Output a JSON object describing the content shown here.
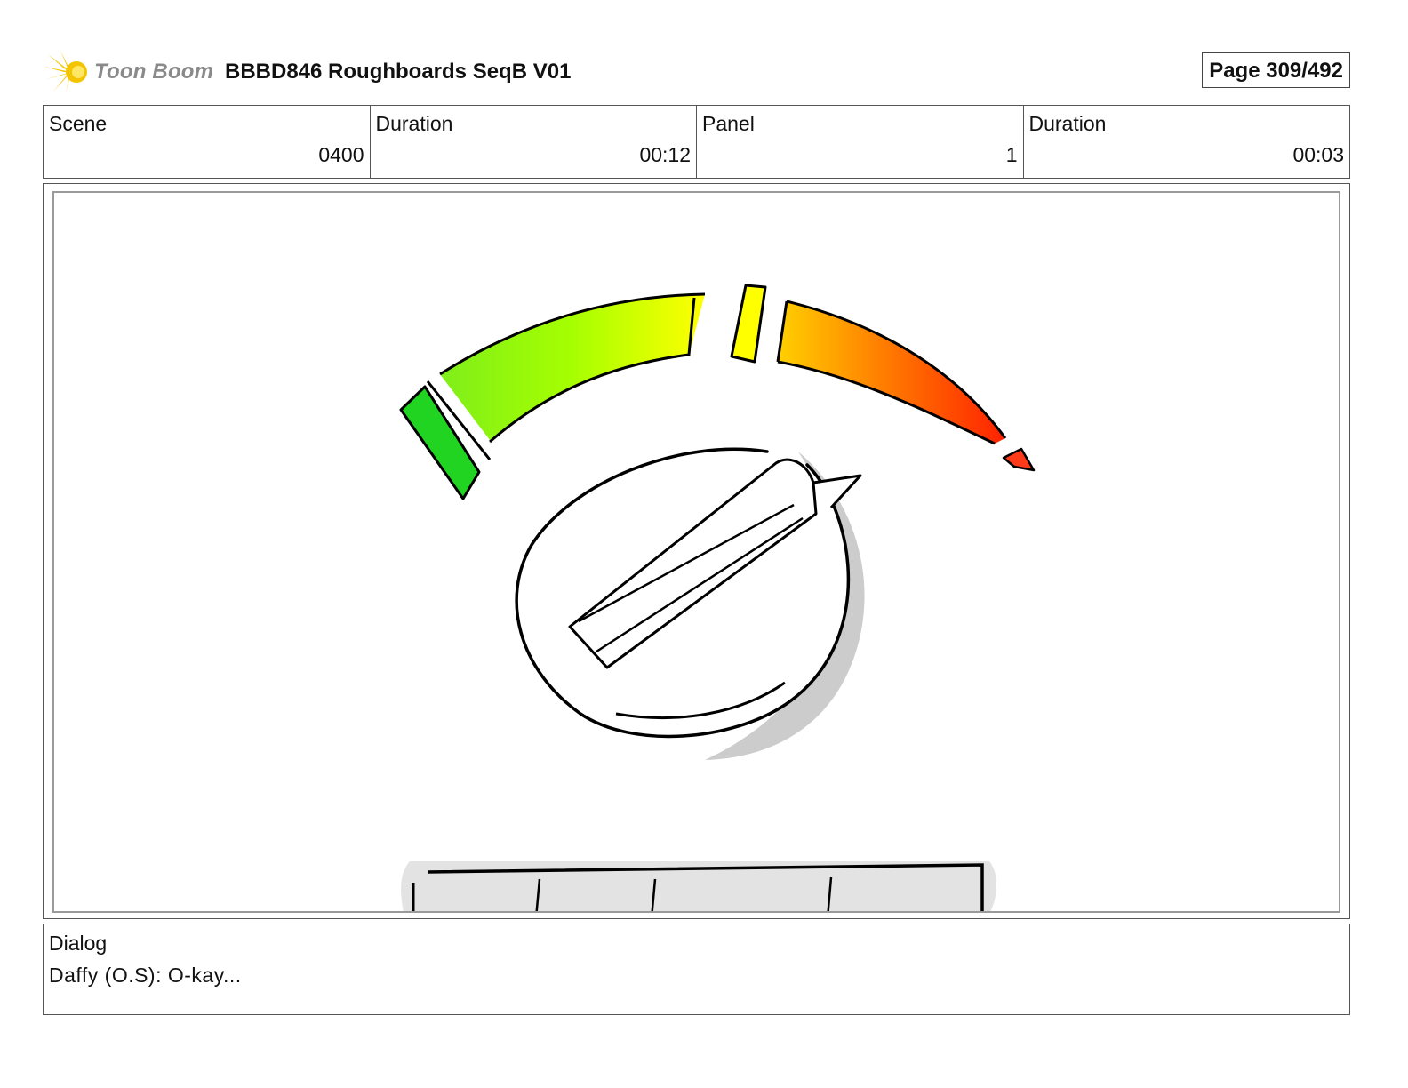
{
  "header": {
    "logo_text": "Toon Boom",
    "title": "BBBD846 Roughboards SeqB V01",
    "page": "Page 309/492"
  },
  "info": {
    "scene_label": "Scene",
    "scene_value": "0400",
    "scene_duration_label": "Duration",
    "scene_duration_value": "00:12",
    "panel_label": "Panel",
    "panel_value": "1",
    "panel_duration_label": "Duration",
    "panel_duration_value": "00:03"
  },
  "dialog": {
    "label": "Dialog",
    "text": "Daffy (O.S): O-kay..."
  },
  "colors": {
    "logo_yellow": "#f5c400",
    "gauge_green": "#22d422",
    "gauge_lime": "#a6ff00",
    "gauge_yellow": "#ffff00",
    "gauge_orange": "#ff8800",
    "gauge_red": "#ff2200",
    "shadow_gray": "#cccccc"
  },
  "icons": {
    "logo": "toon-boom-starburst-icon"
  }
}
